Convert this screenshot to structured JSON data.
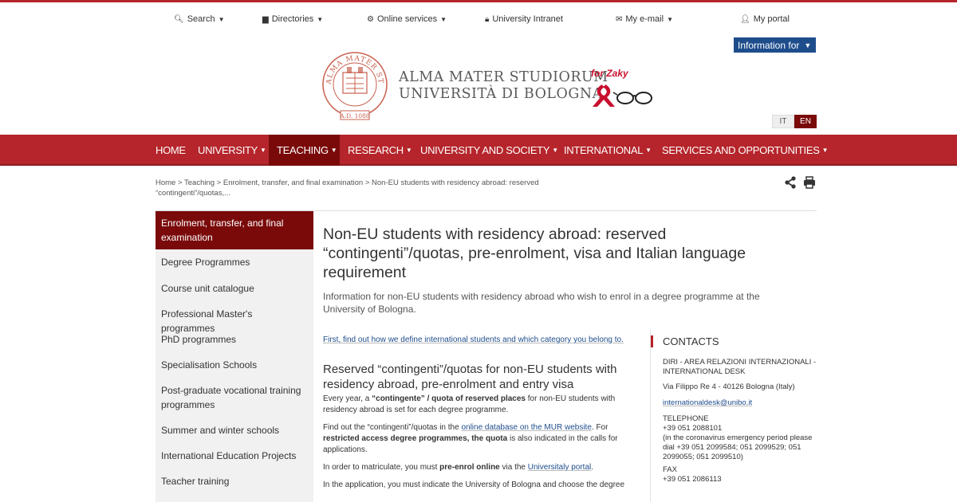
{
  "utility": {
    "search": "Search",
    "directories": "Directories",
    "online_services": "Online services",
    "intranet": "University Intranet",
    "email": "My e-mail",
    "portal": "My portal"
  },
  "information_for": "Information for",
  "logo": {
    "line1": "ALMA MATER STUDIORUM",
    "line2": "UNIVERSITÀ DI BOLOGNA",
    "for_zaky": "for Zaky",
    "seal_text": "ALMA MATER STUDIORUM",
    "seal_year": "A.D. 1088"
  },
  "languages": {
    "it": "IT",
    "en": "EN"
  },
  "nav": [
    "HOME",
    "UNIVERSITY",
    "TEACHING",
    "RESEARCH",
    "UNIVERSITY AND SOCIETY",
    "INTERNATIONAL",
    "SERVICES AND OPPORTUNITIES"
  ],
  "breadcrumb": {
    "home": "Home",
    "teaching": "Teaching",
    "enrolment": "Enrolment, transfer, and final examination",
    "current": "Non-EU students with residency abroad: reserved “contingenti”/quotas,..."
  },
  "sidebar": [
    "Enrolment, transfer, and final examination",
    "Degree Programmes",
    "Course unit catalogue",
    "Professional Master's programmes",
    "PhD programmes",
    "Specialisation Schools",
    "Post-graduate vocational training programmes",
    "Summer and winter schools",
    "International Education Projects",
    "Teacher training"
  ],
  "page": {
    "title": "Non-EU students with residency abroad: reserved “contingenti”/quotas, pre-enrolment, visa and Italian language requirement",
    "intro": "Information for non-EU students with residency abroad who wish to enrol in a degree programme at the University of Bologna."
  },
  "content": {
    "first_link": "First, find out how we define international students and which category you belong to.",
    "heading": "Reserved “contingenti”/quotas for non-EU students with residency abroad, pre-enrolment and entry visa",
    "p1_a": "Every year, a ",
    "p1_b": "“contingente” / quota of reserved places",
    "p1_c": " for non-EU students with residency abroad is set for each degree programme.",
    "p2_a": "Find out the “contingenti”/quotas in the ",
    "p2_link": "online database on the MUR website",
    "p2_b": ". For ",
    "p2_c": "restricted access degree programmes, the quota",
    "p2_d": " is also indicated in the calls for applications.",
    "p3_a": "In order to matriculate, you must ",
    "p3_b": "pre-enrol online",
    "p3_c": " via the ",
    "p3_link": "Universitaly portal",
    "p3_d": ".",
    "p4": "In the application, you must indicate the University of Bologna and choose the degree"
  },
  "contacts": {
    "title": "CONTACTS",
    "org": "DIRI - AREA RELAZIONI INTERNAZIONALI - INTERNATIONAL DESK",
    "address": "Via Filippo Re 4 - 40126 Bologna (Italy)",
    "email": "internationaldesk@unibo.it",
    "tel_label": "TELEPHONE",
    "tel": "+39 051 2088101",
    "tel_note": "(in the coronavirus emergency period please dial +39 051 2099584; 051 2099529; 051 2099055; 051 2099510)",
    "fax_label": "FAX",
    "fax": "+39 051 2086113"
  },
  "colors": {
    "brand_red": "#b5252b",
    "dark_red": "#7a0a0a",
    "blue": "#1e4d8c"
  }
}
